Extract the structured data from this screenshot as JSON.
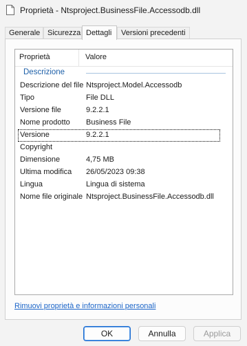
{
  "window": {
    "title": "Proprietà - Ntsproject.BusinessFile.Accessodb.dll"
  },
  "tabs": [
    {
      "label": "Generale",
      "active": false
    },
    {
      "label": "Sicurezza",
      "active": false
    },
    {
      "label": "Dettagli",
      "active": true
    },
    {
      "label": "Versioni precedenti",
      "active": false
    }
  ],
  "details": {
    "columns": {
      "property": "Proprietà",
      "value": "Valore"
    },
    "group_label": "Descrizione",
    "rows": [
      {
        "key": "Descrizione del file",
        "value": "Ntsproject.Model.Accessodb"
      },
      {
        "key": "Tipo",
        "value": "File DLL"
      },
      {
        "key": "Versione file",
        "value": "9.2.2.1"
      },
      {
        "key": "Nome prodotto",
        "value": "Business File"
      },
      {
        "key": "Versione",
        "value": "9.2.2.1"
      },
      {
        "key": "Copyright",
        "value": ""
      },
      {
        "key": "Dimensione",
        "value": "4,75 MB"
      },
      {
        "key": "Ultima modifica",
        "value": "26/05/2023 09:38"
      },
      {
        "key": "Lingua",
        "value": "Lingua di sistema"
      },
      {
        "key": "Nome file originale",
        "value": "Ntsproject.BusinessFile.Accessodb.dll"
      }
    ]
  },
  "remove_link": "Rimuovi proprietà e informazioni personali",
  "buttons": {
    "ok": "OK",
    "cancel": "Annulla",
    "apply": "Applica"
  }
}
